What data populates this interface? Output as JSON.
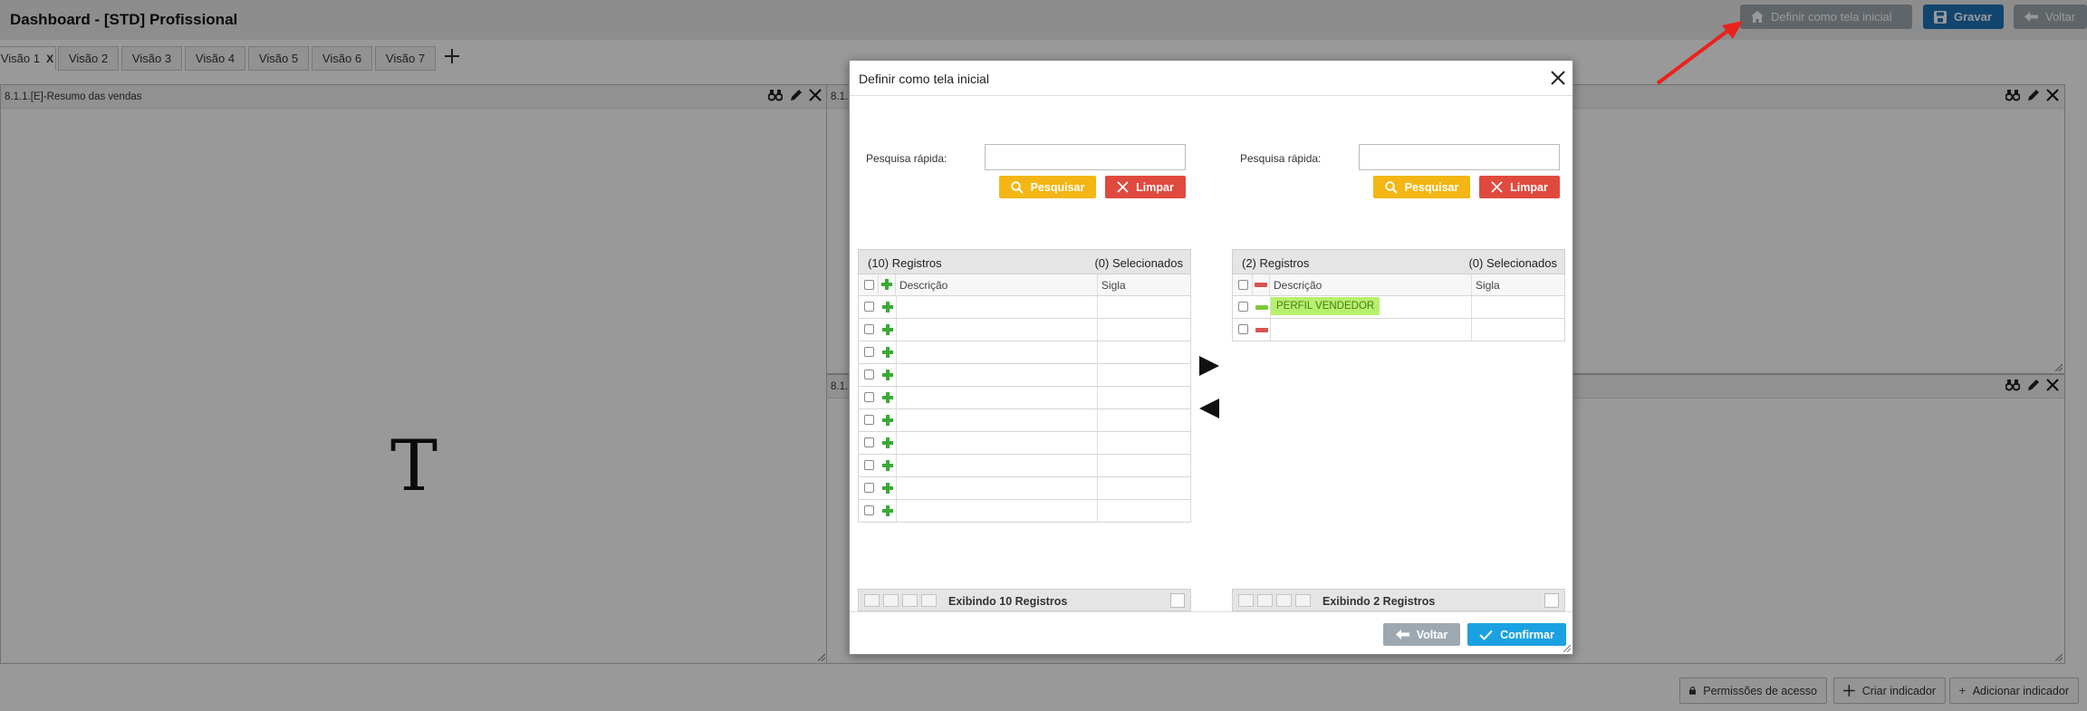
{
  "app": {
    "title": "Dashboard - [STD] Profissional",
    "set_home_label": "Definir como tela inicial",
    "save_label": "Gravar",
    "back_label": "Voltar"
  },
  "tabs": [
    {
      "label": "Visão 1",
      "close": "X",
      "active": true
    },
    {
      "label": "Visão 2"
    },
    {
      "label": "Visão 3"
    },
    {
      "label": "Visão 4"
    },
    {
      "label": "Visão 5"
    },
    {
      "label": "Visão 6"
    },
    {
      "label": "Visão 7"
    }
  ],
  "panels": {
    "p1_title": "8.1.1.[E]-Resumo das vendas",
    "p2_title": "8.1.",
    "p4_title": "8.1.",
    "big_glyph": "T"
  },
  "bottom_actions": {
    "permissions": "Permissões de acesso",
    "create_indicator": "Criar indicador",
    "add_indicator": "Adicionar indicador"
  },
  "modal": {
    "title": "Definir como tela inicial",
    "left": {
      "search_label": "Pesquisa rápida:",
      "search_value": "",
      "search_btn": "Pesquisar",
      "clear_btn": "Limpar",
      "count": "(10) Registros",
      "selected": "(0) Selecionados",
      "col_desc": "Descrição",
      "col_sig": "Sigla",
      "rows": [
        {
          "desc": "",
          "sig": ""
        },
        {
          "desc": "",
          "sig": ""
        },
        {
          "desc": "",
          "sig": ""
        },
        {
          "desc": "",
          "sig": ""
        },
        {
          "desc": "",
          "sig": ""
        },
        {
          "desc": "",
          "sig": ""
        },
        {
          "desc": "",
          "sig": ""
        },
        {
          "desc": "",
          "sig": ""
        },
        {
          "desc": "",
          "sig": ""
        },
        {
          "desc": "",
          "sig": ""
        }
      ],
      "footer": "Exibindo 10 Registros"
    },
    "right": {
      "search_label": "Pesquisa rápida:",
      "search_value": "",
      "search_btn": "Pesquisar",
      "clear_btn": "Limpar",
      "count": "(2) Registros",
      "selected": "(0) Selecionados",
      "col_desc": "Descrição",
      "col_sig": "Sigla",
      "rows": [
        {
          "desc": "PERFIL VENDEDOR",
          "sig": ""
        },
        {
          "desc": "",
          "sig": ""
        }
      ],
      "footer": "Exibindo 2 Registros"
    },
    "back_btn": "Voltar",
    "confirm_btn": "Confirmar"
  },
  "colors": {
    "accent_blue": "#1f74b8",
    "confirm_blue": "#1ba1e2",
    "search_yellow": "#f3b614",
    "clear_red": "#e04a3e",
    "highlight_green": "#b7f06e",
    "annotation_red": "#e8221c"
  }
}
